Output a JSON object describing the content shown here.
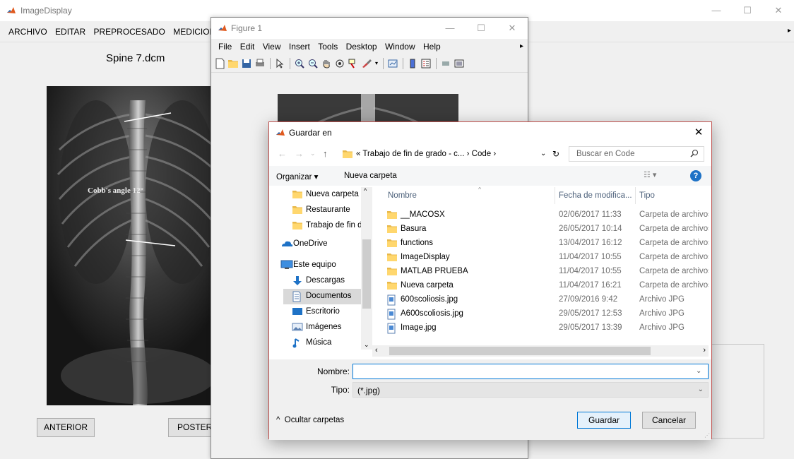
{
  "main_window": {
    "title": "ImageDisplay",
    "menu": [
      "ARCHIVO",
      "EDITAR",
      "PREPROCESADO",
      "MEDICIONES"
    ],
    "file_title": "Spine 7.dcm",
    "cobb_label": "Cobb's angle 12°",
    "btn_prev": "ANTERIOR",
    "btn_next": "POSTER"
  },
  "figure_window": {
    "title": "Figure 1",
    "menu": [
      "File",
      "Edit",
      "View",
      "Insert",
      "Tools",
      "Desktop",
      "Window",
      "Help"
    ],
    "toolbar_icons": [
      "new-figure-icon",
      "open-icon",
      "save-icon",
      "print-icon",
      "pointer-icon",
      "zoom-in-icon",
      "zoom-out-icon",
      "pan-icon",
      "rotate-3d-icon",
      "data-cursor-icon",
      "brush-icon",
      "link-plot-icon",
      "colorbar-icon",
      "legend-icon",
      "hide-plot-tools-icon",
      "show-plot-tools-icon"
    ]
  },
  "dialog": {
    "title": "Guardar en",
    "path": "« Trabajo de fin de grado - c...  ›  Code  ›",
    "search_placeholder": "Buscar en Code",
    "organize": "Organizar ▾",
    "new_folder": "Nueva carpeta",
    "nav_items": [
      {
        "label": "Nueva carpeta",
        "icon": "folder-icon"
      },
      {
        "label": "Restaurante",
        "icon": "folder-icon"
      },
      {
        "label": "Trabajo de fin de",
        "icon": "folder-icon"
      },
      {
        "label": "OneDrive",
        "icon": "onedrive-icon"
      },
      {
        "label": "Este equipo",
        "icon": "computer-icon"
      },
      {
        "label": "Descargas",
        "icon": "downloads-icon"
      },
      {
        "label": "Documentos",
        "icon": "documents-icon"
      },
      {
        "label": "Escritorio",
        "icon": "desktop-icon"
      },
      {
        "label": "Imágenes",
        "icon": "images-icon"
      },
      {
        "label": "Música",
        "icon": "music-icon"
      }
    ],
    "columns": {
      "name": "Nombre",
      "date": "Fecha de modifica...",
      "type": "Tipo"
    },
    "files": [
      {
        "name": "__MACOSX",
        "date": "02/06/2017 11:33",
        "type": "Carpeta de archivos",
        "kind": "folder"
      },
      {
        "name": "Basura",
        "date": "26/05/2017 10:14",
        "type": "Carpeta de archivos",
        "kind": "folder"
      },
      {
        "name": "functions",
        "date": "13/04/2017 16:12",
        "type": "Carpeta de archivos",
        "kind": "folder"
      },
      {
        "name": "ImageDisplay",
        "date": "11/04/2017 10:55",
        "type": "Carpeta de archivos",
        "kind": "folder"
      },
      {
        "name": "MATLAB PRUEBA",
        "date": "11/04/2017 10:55",
        "type": "Carpeta de archivos",
        "kind": "folder"
      },
      {
        "name": "Nueva carpeta",
        "date": "11/04/2017 16:21",
        "type": "Carpeta de archivos",
        "kind": "folder"
      },
      {
        "name": "600scoliosis.jpg",
        "date": "27/09/2016 9:42",
        "type": "Archivo JPG",
        "kind": "jpg"
      },
      {
        "name": "A600scoliosis.jpg",
        "date": "29/05/2017 12:53",
        "type": "Archivo JPG",
        "kind": "jpg"
      },
      {
        "name": "Image.jpg",
        "date": "29/05/2017 13:39",
        "type": "Archivo JPG",
        "kind": "jpg"
      }
    ],
    "name_label": "Nombre:",
    "name_value": "",
    "type_label": "Tipo:",
    "type_value": "(*.jpg)",
    "hide_folders": "Ocultar carpetas",
    "btn_save": "Guardar",
    "btn_cancel": "Cancelar"
  },
  "colors": {
    "accent": "#0078d7",
    "dialog_border": "#c0504d",
    "folder": "#ffd76e"
  }
}
